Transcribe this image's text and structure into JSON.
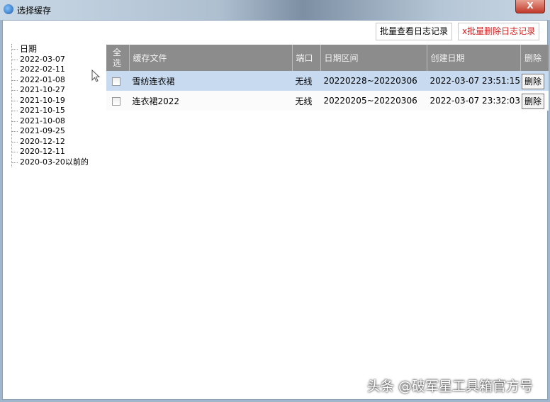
{
  "window": {
    "title": "选择缓存",
    "close": "X"
  },
  "toolbar": {
    "batch_view": "批量查看日志记录",
    "batch_delete": "x批量删除日志记录"
  },
  "tree": {
    "root": "日期",
    "items": [
      "2022-03-07",
      "2022-02-11",
      "2022-01-08",
      "2021-10-27",
      "2021-10-19",
      "2021-10-15",
      "2021-10-08",
      "2021-09-25",
      "2020-12-12",
      "2020-12-11",
      "2020-03-20以前的"
    ]
  },
  "table": {
    "headers": [
      "全选",
      "缓存文件",
      "端口",
      "日期区间",
      "创建日期",
      "删除"
    ],
    "rows": [
      {
        "file": "雪纺连衣裙",
        "port": "无线",
        "range": "20220228~20220306",
        "created": "2022-03-07 23:51:15",
        "action": "删除"
      },
      {
        "file": "连衣裙2022",
        "port": "无线",
        "range": "20220205~20220306",
        "created": "2022-03-07 23:32:03",
        "action": "删除"
      }
    ]
  },
  "watermark": "头条 @破军星工具箱官方号"
}
